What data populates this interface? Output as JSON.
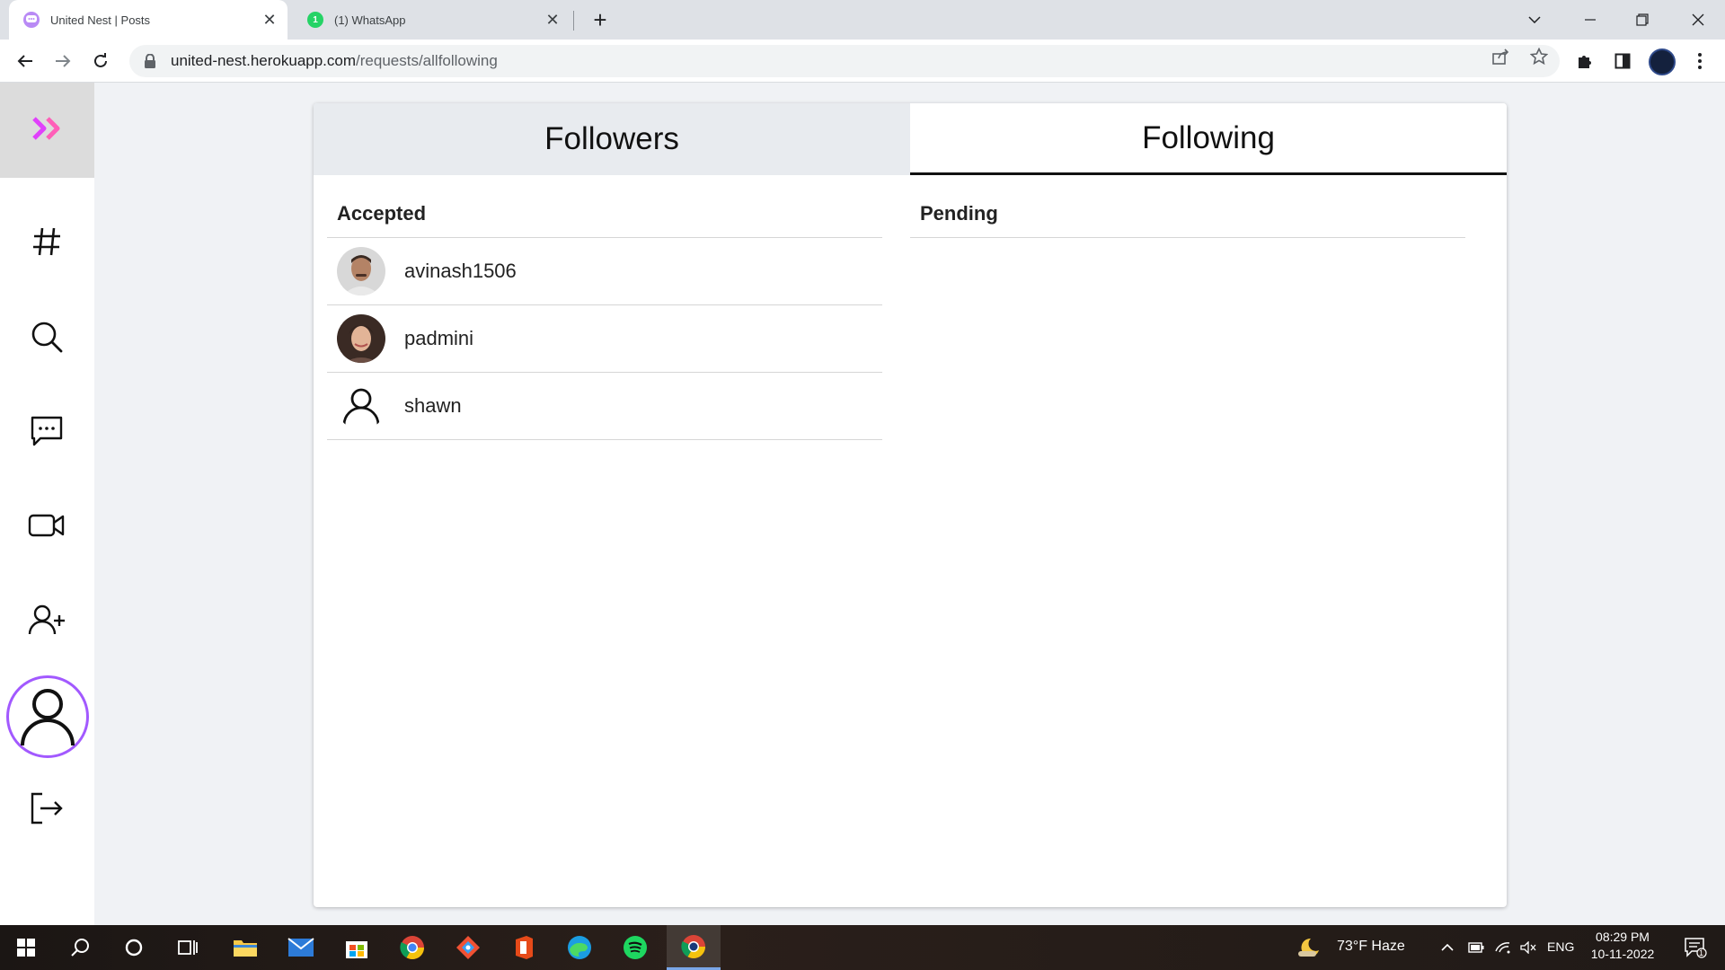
{
  "browser": {
    "tabs": [
      {
        "title": "United Nest | Posts",
        "favicon": "united-nest-chat-icon",
        "active": true
      },
      {
        "title": "(1) WhatsApp",
        "favicon": "whatsapp-icon",
        "badge": "1",
        "active": false
      }
    ],
    "url_host": "united-nest.herokuapp.com",
    "url_path": "/requests/allfollowing"
  },
  "sidebar": {
    "items": [
      {
        "icon": "double-chevron-right-icon"
      },
      {
        "icon": "hashtag-icon"
      },
      {
        "icon": "search-icon"
      },
      {
        "icon": "chat-bubble-icon"
      },
      {
        "icon": "video-camera-icon"
      },
      {
        "icon": "add-user-icon"
      },
      {
        "icon": "profile-avatar-icon"
      },
      {
        "icon": "logout-icon"
      }
    ],
    "accent": "#a259ff",
    "logo_color": "#e040fb"
  },
  "main": {
    "tabs": [
      {
        "label": "Followers",
        "selected": false
      },
      {
        "label": "Following",
        "selected": true
      }
    ],
    "accepted": {
      "header": "Accepted",
      "users": [
        {
          "name": "avinash1506",
          "avatar": "photo"
        },
        {
          "name": "padmini",
          "avatar": "photo"
        },
        {
          "name": "shawn",
          "avatar": "default-user-icon"
        }
      ]
    },
    "pending": {
      "header": "Pending",
      "users": []
    }
  },
  "taskbar": {
    "weather": "73°F  Haze",
    "language": "ENG",
    "time": "08:29 PM",
    "date": "10-11-2022",
    "notification_count": "1"
  }
}
